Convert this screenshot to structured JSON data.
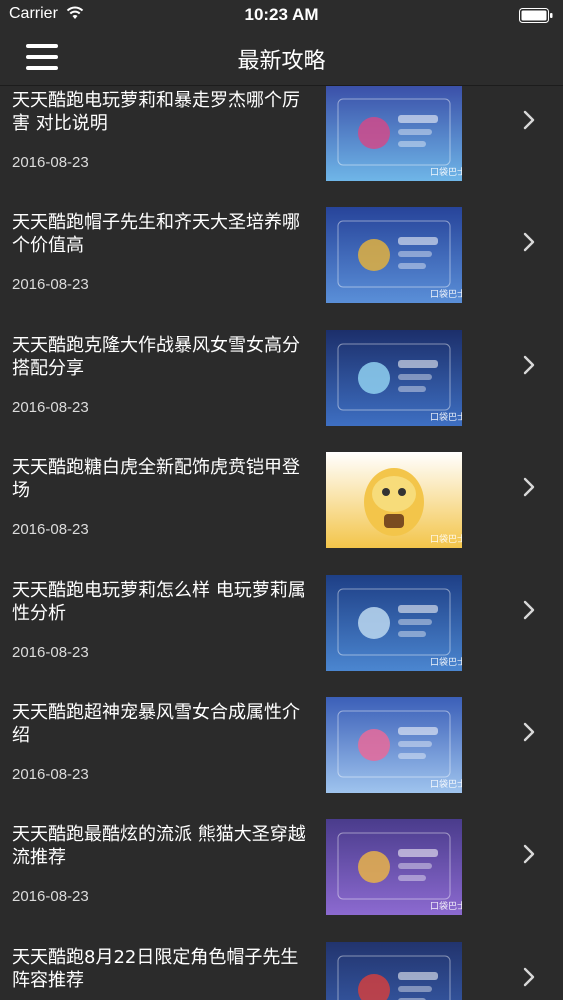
{
  "status_bar": {
    "carrier": "Carrier",
    "time": "10:23 AM"
  },
  "nav": {
    "title": "最新攻略"
  },
  "articles": [
    {
      "title": "天天酷跑电玩萝莉和暴走罗杰哪个厉害 对比说明",
      "date": "2016-08-23"
    },
    {
      "title": "天天酷跑帽子先生和齐天大圣培养哪个价值高",
      "date": "2016-08-23"
    },
    {
      "title": "天天酷跑克隆大作战暴风女雪女高分搭配分享",
      "date": "2016-08-23"
    },
    {
      "title": "天天酷跑糖白虎全新配饰虎贲铠甲登场",
      "date": "2016-08-23"
    },
    {
      "title": "天天酷跑电玩萝莉怎么样 电玩萝莉属性分析",
      "date": "2016-08-23"
    },
    {
      "title": "天天酷跑超神宠暴风雪女合成属性介绍",
      "date": "2016-08-23"
    },
    {
      "title": "天天酷跑最酷炫的流派 熊猫大圣穿越流推荐",
      "date": "2016-08-23"
    },
    {
      "title": "天天酷跑8月22日限定角色帽子先生阵容推荐",
      "date": ""
    }
  ],
  "thumb_watermark": "口袋巴士",
  "colors": {
    "background": "#2b2b2b",
    "bar": "#2c2c2c",
    "text": "#ffffff",
    "chevron": "#d8d8d8"
  }
}
